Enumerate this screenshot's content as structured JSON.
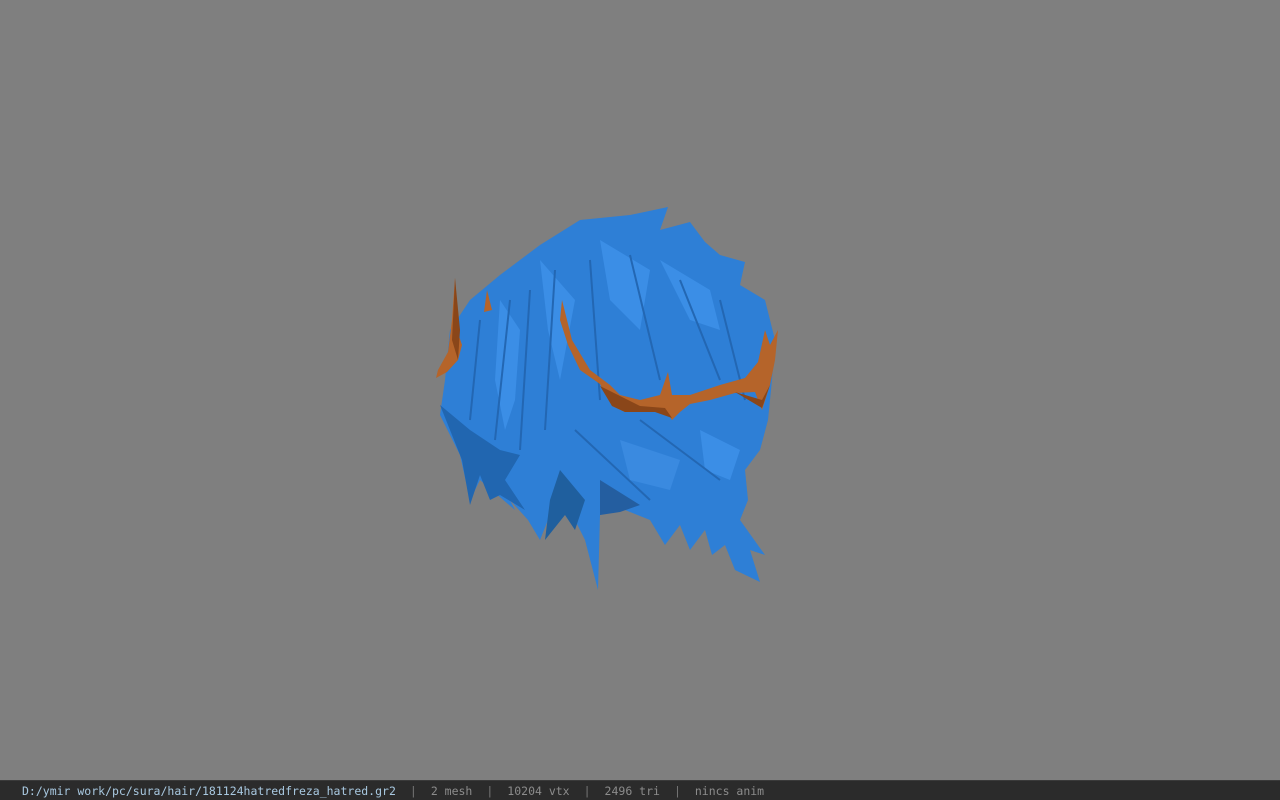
{
  "viewport": {
    "background": "#7f7f7f",
    "model": {
      "hair_color": "#2e7fd6",
      "hair_shadow": "#1f5f9e",
      "crown_color": "#b5642a",
      "crown_shadow": "#8a4619"
    }
  },
  "status_bar": {
    "path": "D:/ymir work/pc/sura/hair/181124hatredfreza_hatred.gr2",
    "separator": "|",
    "mesh": "2 mesh",
    "vtx": "10204 vtx",
    "tri": "2496 tri",
    "anim": "nincs anim"
  }
}
